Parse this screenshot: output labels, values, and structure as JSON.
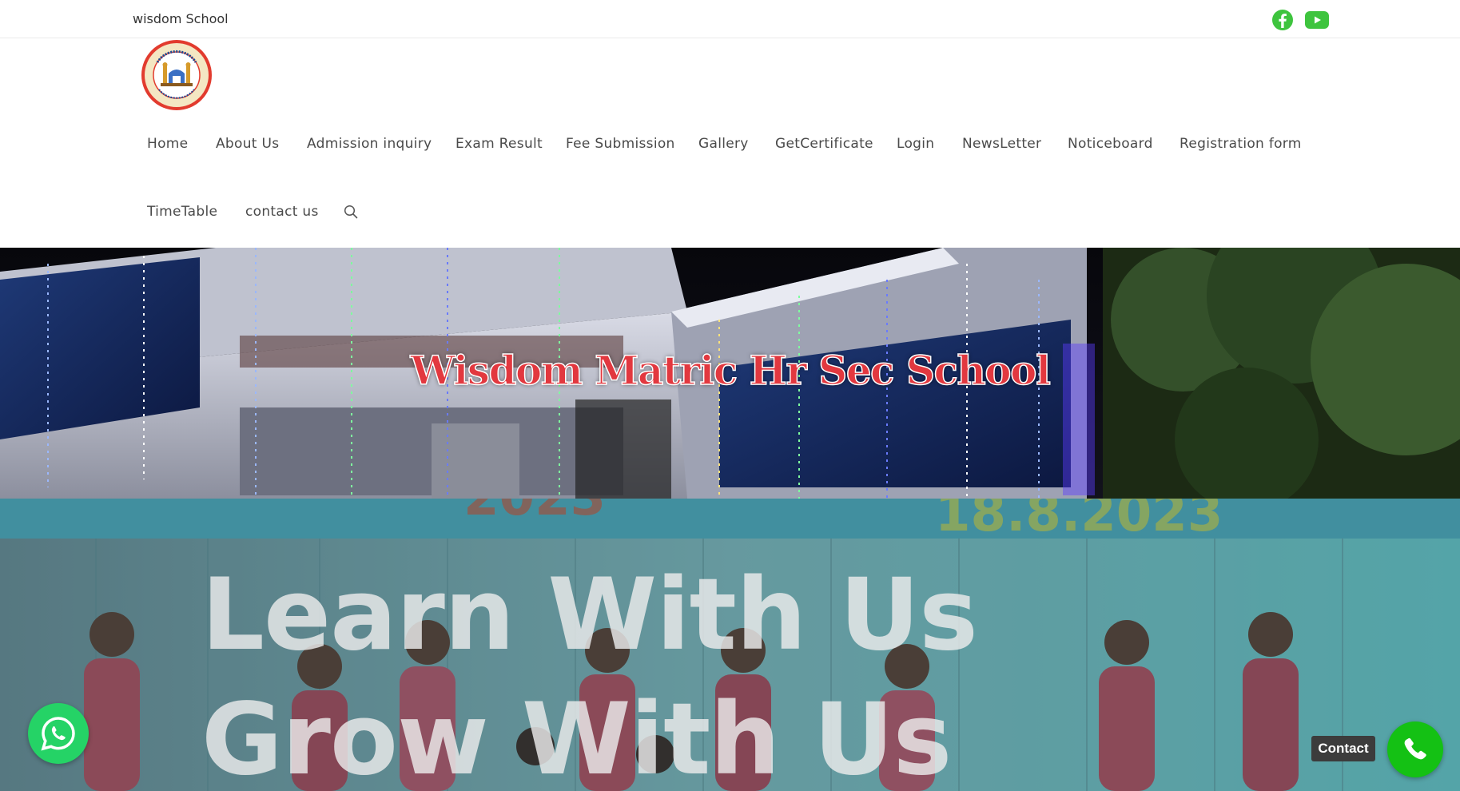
{
  "topbar": {
    "site_label": "wisdom School",
    "social": [
      {
        "icon": "facebook-icon",
        "color": "#3ec43e"
      },
      {
        "icon": "youtube-icon",
        "color": "#3ec43e"
      }
    ]
  },
  "logo": {
    "alt": "Wisdom Matric Hr. Sec. School logo",
    "colors": {
      "ring": "#e23b2e",
      "inner": "#f4e7c3",
      "text": "#1b4c96"
    }
  },
  "nav": {
    "items": [
      {
        "label": "Home"
      },
      {
        "label": "About Us"
      },
      {
        "label": "Admission inquiry"
      },
      {
        "label": "Exam Result"
      },
      {
        "label": "Fee Submission"
      },
      {
        "label": "Gallery"
      },
      {
        "label": "GetCertificate"
      },
      {
        "label": "Login"
      },
      {
        "label": "NewsLetter"
      },
      {
        "label": "Noticeboard"
      },
      {
        "label": "Registration form"
      },
      {
        "label": "TimeTable"
      },
      {
        "label": "contact us"
      }
    ],
    "search_icon": "search-icon"
  },
  "hero1": {
    "title": "Wisdom Matric Hr Sec School",
    "title_color": "#e2383f"
  },
  "hero2": {
    "line1": "Learn With Us",
    "line2": "Grow With Us",
    "banner_text": "18.8.2023"
  },
  "floating": {
    "whatsapp_icon": "whatsapp-icon",
    "contact_label": "Contact",
    "call_icon": "phone-icon",
    "whatsapp_color": "#25d366",
    "call_color": "#14c114"
  }
}
